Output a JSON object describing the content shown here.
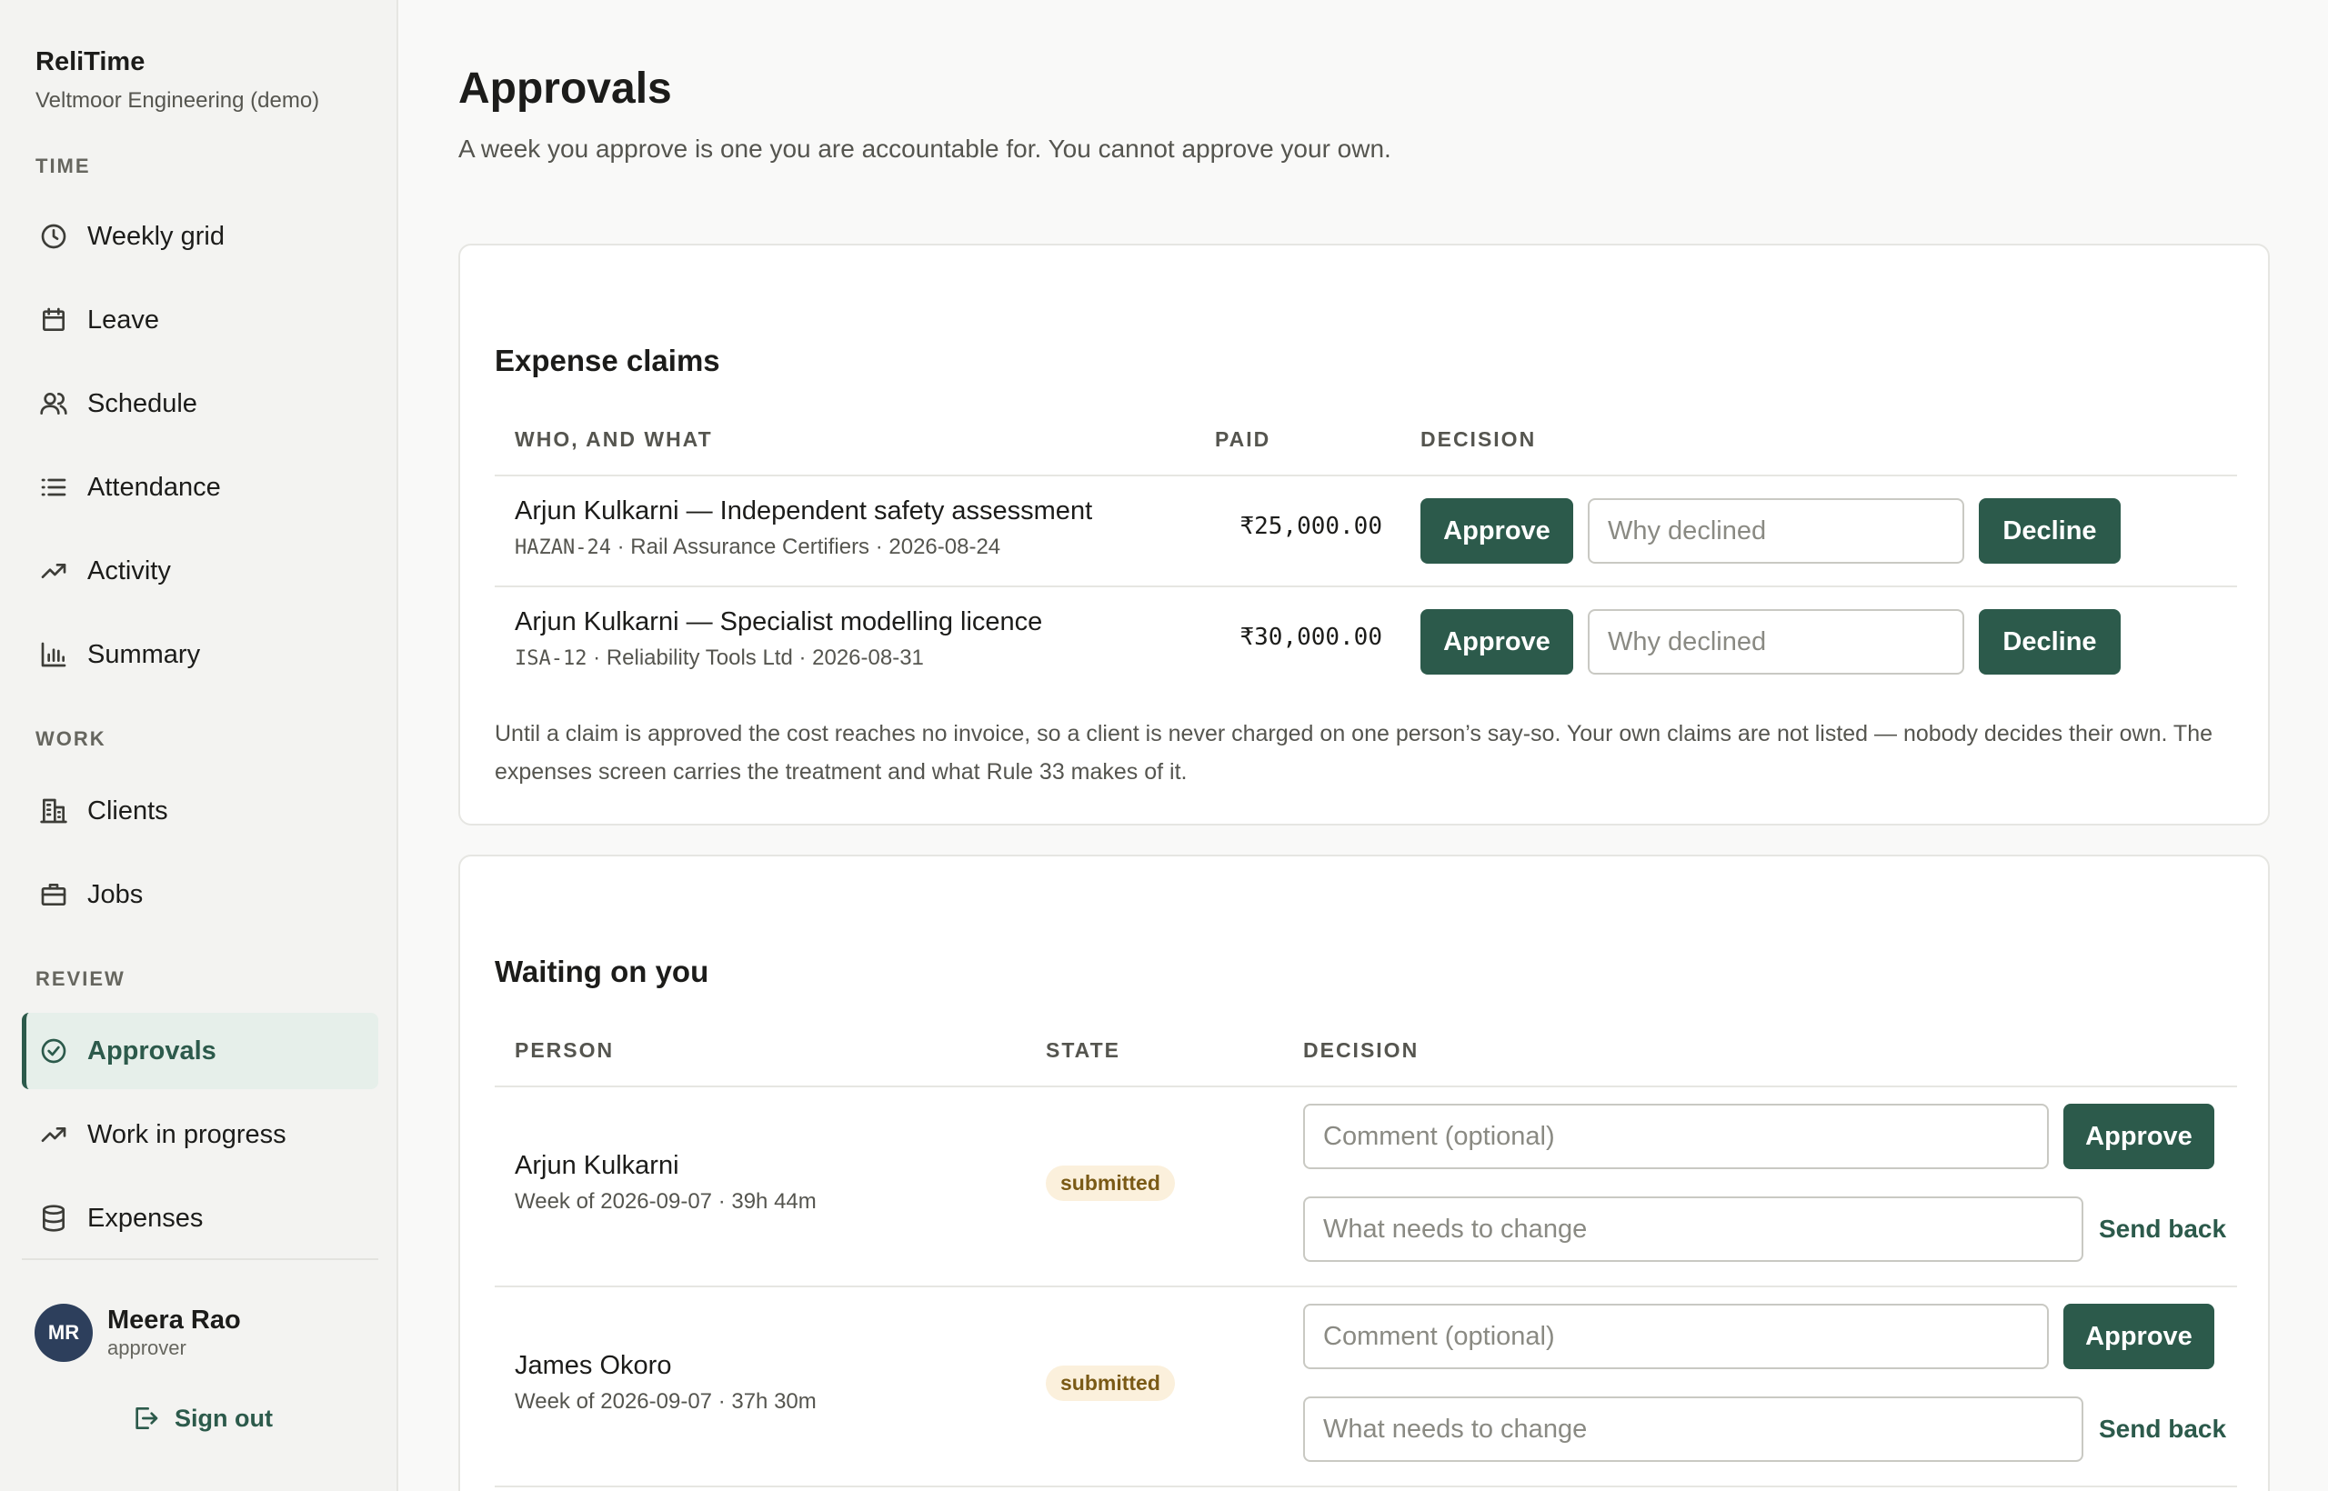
{
  "app": {
    "name": "ReliTime",
    "org": "Veltmoor Engineering (demo)"
  },
  "sidebar": {
    "sections": [
      {
        "label": "TIME"
      },
      {
        "label": "WORK"
      },
      {
        "label": "REVIEW"
      }
    ],
    "items": [
      {
        "label": "Weekly grid",
        "icon": "clock-icon"
      },
      {
        "label": "Leave",
        "icon": "calendar-icon"
      },
      {
        "label": "Schedule",
        "icon": "users-icon"
      },
      {
        "label": "Attendance",
        "icon": "list-icon"
      },
      {
        "label": "Activity",
        "icon": "trending-up-icon"
      },
      {
        "label": "Summary",
        "icon": "bar-chart-icon"
      },
      {
        "label": "Clients",
        "icon": "building-icon"
      },
      {
        "label": "Jobs",
        "icon": "briefcase-icon"
      },
      {
        "label": "Approvals",
        "icon": "check-circle-icon",
        "active": true
      },
      {
        "label": "Work in progress",
        "icon": "trending-up-icon"
      },
      {
        "label": "Expenses",
        "icon": "database-icon"
      }
    ],
    "user": {
      "initials": "MR",
      "name": "Meera Rao",
      "role": "approver"
    },
    "sign_out": "Sign out"
  },
  "main": {
    "title": "Approvals",
    "subtitle": "A week you approve is one you are accountable for. You cannot approve your own."
  },
  "expense_claims": {
    "title": "Expense claims",
    "headers": {
      "who": "WHO, AND WHAT",
      "paid": "PAID",
      "decision": "DECISION"
    },
    "rows": [
      {
        "title": "Arjun Kulkarni — Independent safety assessment",
        "code": "HAZAN-24",
        "meta": " · Rail Assurance Certifiers · 2026-08-24",
        "amount": "₹25,000.00",
        "approve": "Approve",
        "decline_placeholder": "Why declined",
        "decline": "Decline"
      },
      {
        "title": "Arjun Kulkarni — Specialist modelling licence",
        "code": "ISA-12",
        "meta": " · Reliability Tools Ltd · 2026-08-31",
        "amount": "₹30,000.00",
        "approve": "Approve",
        "decline_placeholder": "Why declined",
        "decline": "Decline"
      }
    ],
    "note": "Until a claim is approved the cost reaches no invoice, so a client is never charged on one person’s say-so. Your own claims are not listed — nobody decides their own. The expenses screen carries the treatment and what Rule 33 makes of it."
  },
  "waiting": {
    "title": "Waiting on you",
    "headers": {
      "person": "PERSON",
      "state": "STATE",
      "decision": "DECISION"
    },
    "rows": [
      {
        "name": "Arjun Kulkarni",
        "meta": "Week of 2026-09-07 · 39h 44m",
        "state": "submitted",
        "comment_placeholder": "Comment (optional)",
        "approve": "Approve",
        "change_placeholder": "What needs to change",
        "send_back": "Send back"
      },
      {
        "name": "James Okoro",
        "meta": "Week of 2026-09-07 · 37h 30m",
        "state": "submitted",
        "comment_placeholder": "Comment (optional)",
        "approve": "Approve",
        "change_placeholder": "What needs to change",
        "send_back": "Send back"
      }
    ]
  },
  "colors": {
    "accent": "#2c5a4b",
    "badge_bg": "#fbf0dc",
    "badge_text": "#7a5a16"
  }
}
